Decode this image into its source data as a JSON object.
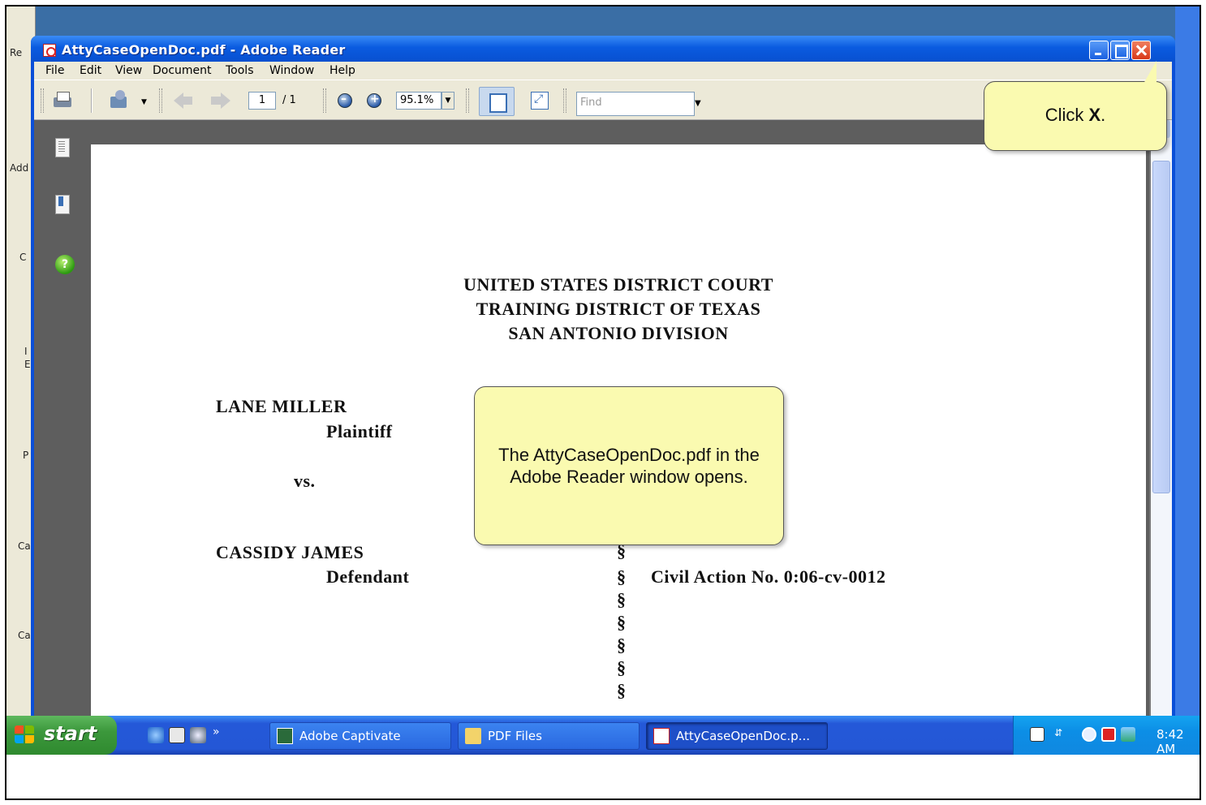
{
  "window": {
    "title": "AttyCaseOpenDoc.pdf - Adobe Reader"
  },
  "menu": [
    "File",
    "Edit",
    "View",
    "Document",
    "Tools",
    "Window",
    "Help"
  ],
  "toolbar": {
    "page_current": "1",
    "page_total": "/ 1",
    "zoom": "95.1%",
    "find_placeholder": "Find"
  },
  "background_window": {
    "fragments": [
      "Re",
      "Add",
      "C",
      "I",
      "E",
      "P",
      "Ca",
      "Ca"
    ]
  },
  "document": {
    "header": [
      "UNITED STATES DISTRICT COURT",
      "TRAINING DISTRICT OF TEXAS",
      "SAN ANTONIO DIVISION"
    ],
    "plaintiff_name": "LANE MILLER",
    "plaintiff_role": "Plaintiff",
    "versus": "vs.",
    "defendant_name": "CASSIDY JAMES",
    "defendant_role": "Defendant",
    "section_symbol": "§",
    "civil_action": "Civil Action No.  0:06-cv-0012"
  },
  "callouts": {
    "click_x_prefix": "Click ",
    "click_x_key": "X",
    "click_x_suffix": ".",
    "main": "The AttyCaseOpenDoc.pdf in the Adobe Reader window opens."
  },
  "taskbar": {
    "start_label": "start",
    "tasks": [
      {
        "label": "Adobe Captivate",
        "icon": "captivate-icon",
        "active": false
      },
      {
        "label": "PDF Files",
        "icon": "folder-icon",
        "active": false
      },
      {
        "label": "AttyCaseOpenDoc.p...",
        "icon": "pdf-icon",
        "active": true
      }
    ],
    "clock": "8:42 AM"
  },
  "colors": {
    "titlebar": "#0a5be0",
    "callout": "#fafab0",
    "taskbar": "#2457d6",
    "start_button": "#3c983c"
  }
}
